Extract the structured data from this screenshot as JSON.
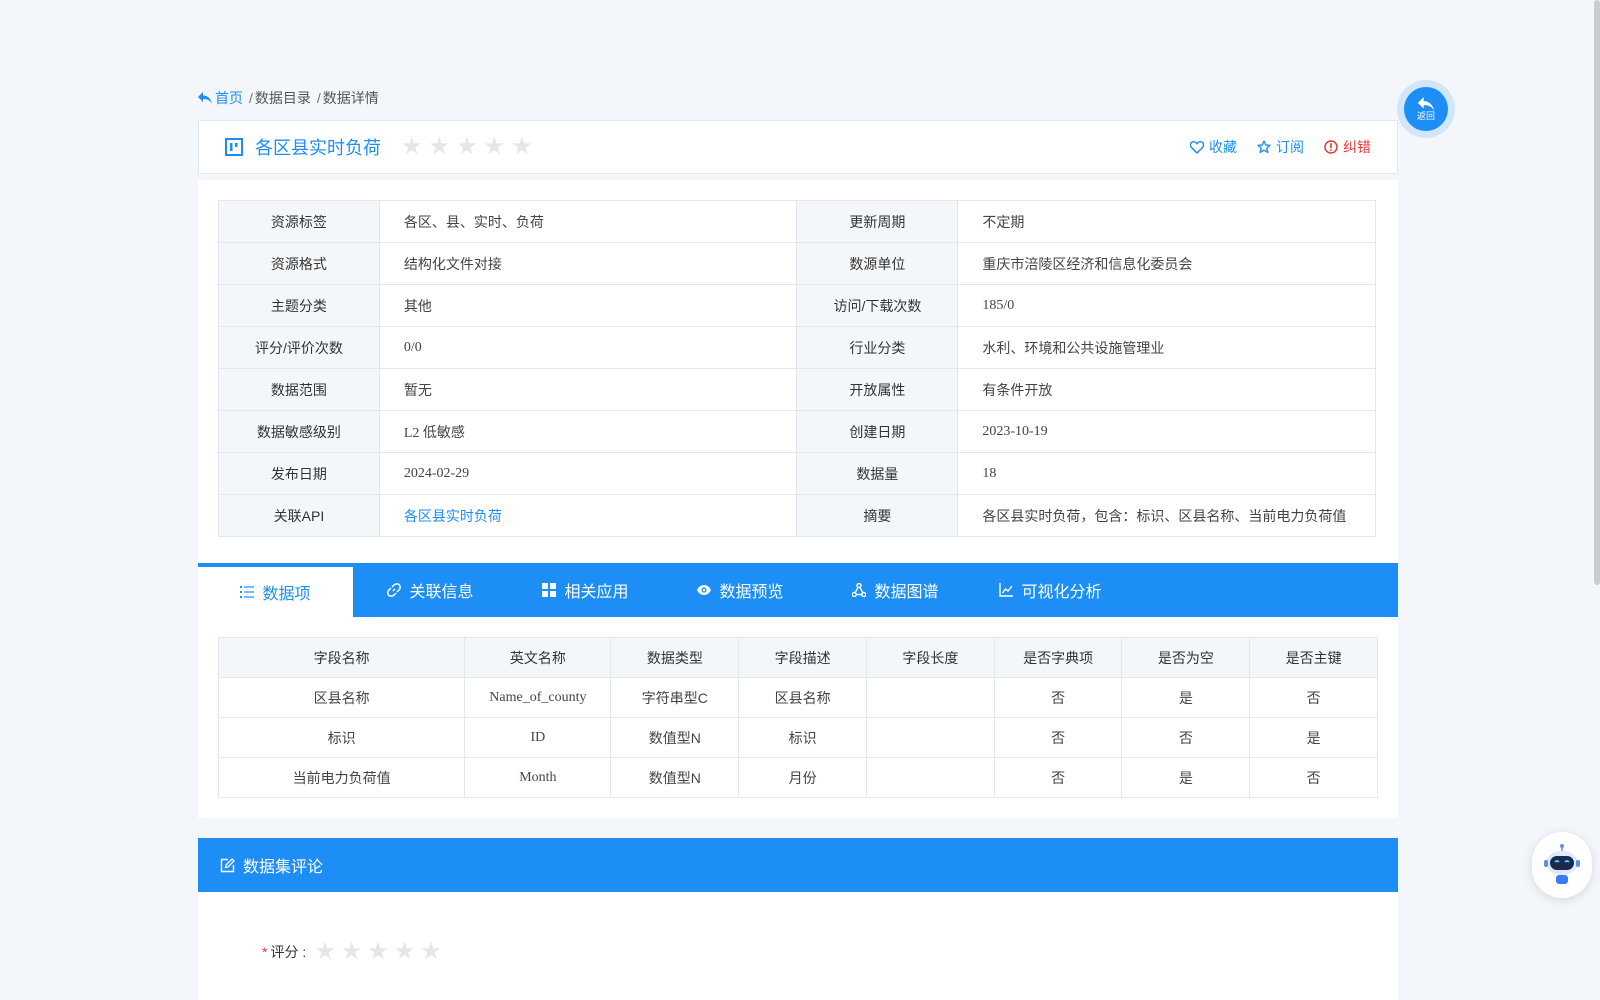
{
  "breadcrumb": {
    "home": "首页",
    "items": [
      "数据目录",
      "数据详情"
    ],
    "separator": "/"
  },
  "back_button": {
    "label": "返回"
  },
  "dataset": {
    "title": "各区县实时负荷",
    "rating_stars": 0,
    "actions": {
      "favorite": "收藏",
      "subscribe": "订阅",
      "report_error": "纠错"
    }
  },
  "info": {
    "rows": [
      {
        "k1": "资源标签",
        "v1": "各区、县、实时、负荷",
        "k2": "更新周期",
        "v2": "不定期"
      },
      {
        "k1": "资源格式",
        "v1": "结构化文件对接",
        "k2": "数源单位",
        "v2": "重庆市涪陵区经济和信息化委员会"
      },
      {
        "k1": "主题分类",
        "v1": "其他",
        "k2": "访问/下载次数",
        "v2": "185/0"
      },
      {
        "k1": "评分/评价次数",
        "v1": "0/0",
        "k2": "行业分类",
        "v2": "水利、环境和公共设施管理业"
      },
      {
        "k1": "数据范围",
        "v1": "暂无",
        "k2": "开放属性",
        "v2": "有条件开放"
      },
      {
        "k1": "数据敏感级别",
        "v1": "L2 低敏感",
        "k2": "创建日期",
        "v2": "2023-10-19"
      },
      {
        "k1": "发布日期",
        "v1": "2024-02-29",
        "k2": "数据量",
        "v2": "18"
      },
      {
        "k1": "关联API",
        "v1": "各区县实时负荷",
        "k2": "摘要",
        "v2": "各区县实时负荷，包含：标识、区县名称、当前电力负荷值"
      }
    ]
  },
  "tabs": [
    {
      "label": "数据项",
      "icon": "list-icon"
    },
    {
      "label": "关联信息",
      "icon": "link-icon"
    },
    {
      "label": "相关应用",
      "icon": "grid-icon"
    },
    {
      "label": "数据预览",
      "icon": "eye-icon"
    },
    {
      "label": "数据图谱",
      "icon": "graph-icon"
    },
    {
      "label": "可视化分析",
      "icon": "line-chart-icon"
    }
  ],
  "fields": {
    "headers": [
      "字段名称",
      "英文名称",
      "数据类型",
      "字段描述",
      "字段长度",
      "是否字典项",
      "是否为空",
      "是否主键"
    ],
    "rows": [
      [
        "区县名称",
        "Name_of_county",
        "字符串型C",
        "区县名称",
        "",
        "否",
        "是",
        "否"
      ],
      [
        "标识",
        "ID",
        "数值型N",
        "标识",
        "",
        "否",
        "否",
        "是"
      ],
      [
        "当前电力负荷值",
        "Month",
        "数值型N",
        "月份",
        "",
        "否",
        "是",
        "否"
      ]
    ]
  },
  "comments": {
    "title": "数据集评论",
    "rating_label": "评分 :",
    "required_mark": "*"
  },
  "colors": {
    "primary": "#1e8ef7",
    "error": "#e53935",
    "star_empty": "#e6e6e6"
  }
}
